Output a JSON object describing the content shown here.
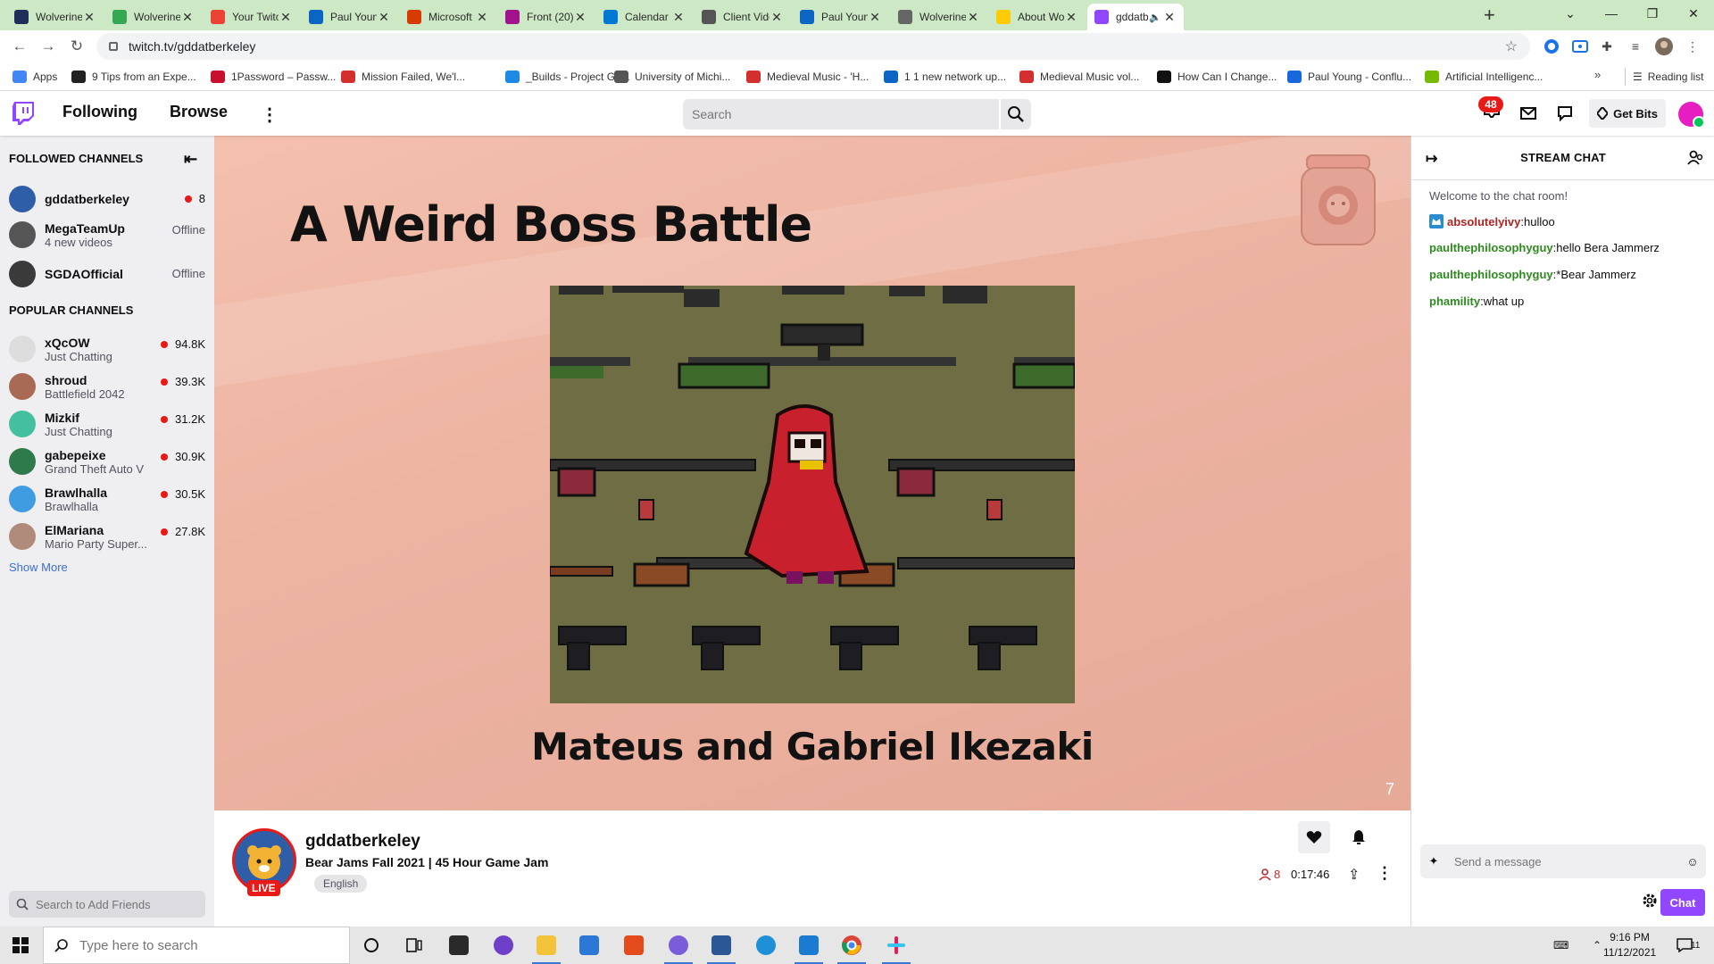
{
  "browser": {
    "tabs": [
      {
        "title": "Wolverine Ac",
        "color": "#1f2d5a"
      },
      {
        "title": "WolverineSof",
        "color": "#34a853"
      },
      {
        "title": "Your Twitch L",
        "color": "#ea4335"
      },
      {
        "title": "Paul Young | L",
        "color": "#0a66c2"
      },
      {
        "title": "Microsoft Off",
        "color": "#d83b01"
      },
      {
        "title": "Front (20)",
        "color": "#a2128c"
      },
      {
        "title": "Calendar - Pa",
        "color": "#0078d4"
      },
      {
        "title": "Client Videos",
        "color": "#555555"
      },
      {
        "title": "Paul Young | L",
        "color": "#0a66c2"
      },
      {
        "title": "WolverineSof",
        "color": "#666666"
      },
      {
        "title": "About Wolve",
        "color": "#ffcb05"
      },
      {
        "title": "gddatbe",
        "color": "#9147ff"
      }
    ],
    "url": "twitch.tv/gddatberkeley",
    "bookmarks": [
      "Apps",
      "9 Tips from an Expe...",
      "1Password – Passw...",
      "Mission Failed, We'l...",
      "_Builds - Project Ge...",
      "University of Michi...",
      "Medieval Music - 'H...",
      "1 1 new network up...",
      "Medieval Music vol...",
      "How Can I Change...",
      "Paul Young - Conflu...",
      "Artificial Intelligenc..."
    ],
    "more_bookmarks": "»",
    "reading_list": "Reading list"
  },
  "twitch_nav": {
    "following": "Following",
    "browse": "Browse",
    "search_placeholder": "Search",
    "notifications_count": "48",
    "get_bits": "Get Bits"
  },
  "sidebar": {
    "followed_header": "FOLLOWED CHANNELS",
    "followed": [
      {
        "name": "gddatberkeley",
        "sub": "",
        "status": "live",
        "viewers": "8",
        "color": "#2f5ea9"
      },
      {
        "name": "MegaTeamUp",
        "sub": "4 new videos",
        "status": "offline",
        "viewers": "Offline",
        "color": "#555555"
      },
      {
        "name": "SGDAOfficial",
        "sub": "",
        "status": "offline",
        "viewers": "Offline",
        "color": "#3a3a3a"
      }
    ],
    "popular_header": "POPULAR CHANNELS",
    "popular": [
      {
        "name": "xQcOW",
        "sub": "Just Chatting",
        "viewers": "94.8K",
        "color": "#dddddd"
      },
      {
        "name": "shroud",
        "sub": "Battlefield 2042",
        "viewers": "39.3K",
        "color": "#a86a55"
      },
      {
        "name": "Mizkif",
        "sub": "Just Chatting",
        "viewers": "31.2K",
        "color": "#44c0a0"
      },
      {
        "name": "gabepeixe",
        "sub": "Grand Theft Auto V",
        "viewers": "30.9K",
        "color": "#2f7a4a"
      },
      {
        "name": "Brawlhalla",
        "sub": "Brawlhalla",
        "viewers": "30.5K",
        "color": "#3f9ce0"
      },
      {
        "name": "ElMariana",
        "sub": "Mario Party Super...",
        "viewers": "27.8K",
        "color": "#b08a7a"
      }
    ],
    "show_more": "Show More",
    "friends_placeholder": "Search to Add Friends"
  },
  "stream": {
    "slide_title": "A Weird Boss Battle",
    "slide_credit": "Mateus and Gabriel Ikezaki",
    "slide_number": "7"
  },
  "channel": {
    "name": "gddatberkeley",
    "title": "Bear Jams Fall 2021 | 45 Hour Game Jam",
    "tag": "English",
    "live": "LIVE",
    "viewers": "8",
    "uptime": "0:17:46"
  },
  "chat": {
    "header": "STREAM CHAT",
    "welcome": "Welcome to the chat room!",
    "messages": [
      {
        "user": "absolutelyivy",
        "text": "hulloo",
        "color": "#b22222",
        "badge": true
      },
      {
        "user": "paulthephilosophyguy",
        "text": "hello Bera Jammerz",
        "color": "#2e8b1f",
        "badge": false
      },
      {
        "user": "paulthephilosophyguy",
        "text": "*Bear Jammerz",
        "color": "#2e8b1f",
        "badge": false
      },
      {
        "user": "phamility",
        "text": "what up",
        "color": "#2e8b1f",
        "badge": false
      }
    ],
    "input_placeholder": "Send a message",
    "send_label": "Chat"
  },
  "taskbar": {
    "search_placeholder": "Type here to search",
    "time": "9:16 PM",
    "date": "11/12/2021",
    "notification_count": "11"
  }
}
